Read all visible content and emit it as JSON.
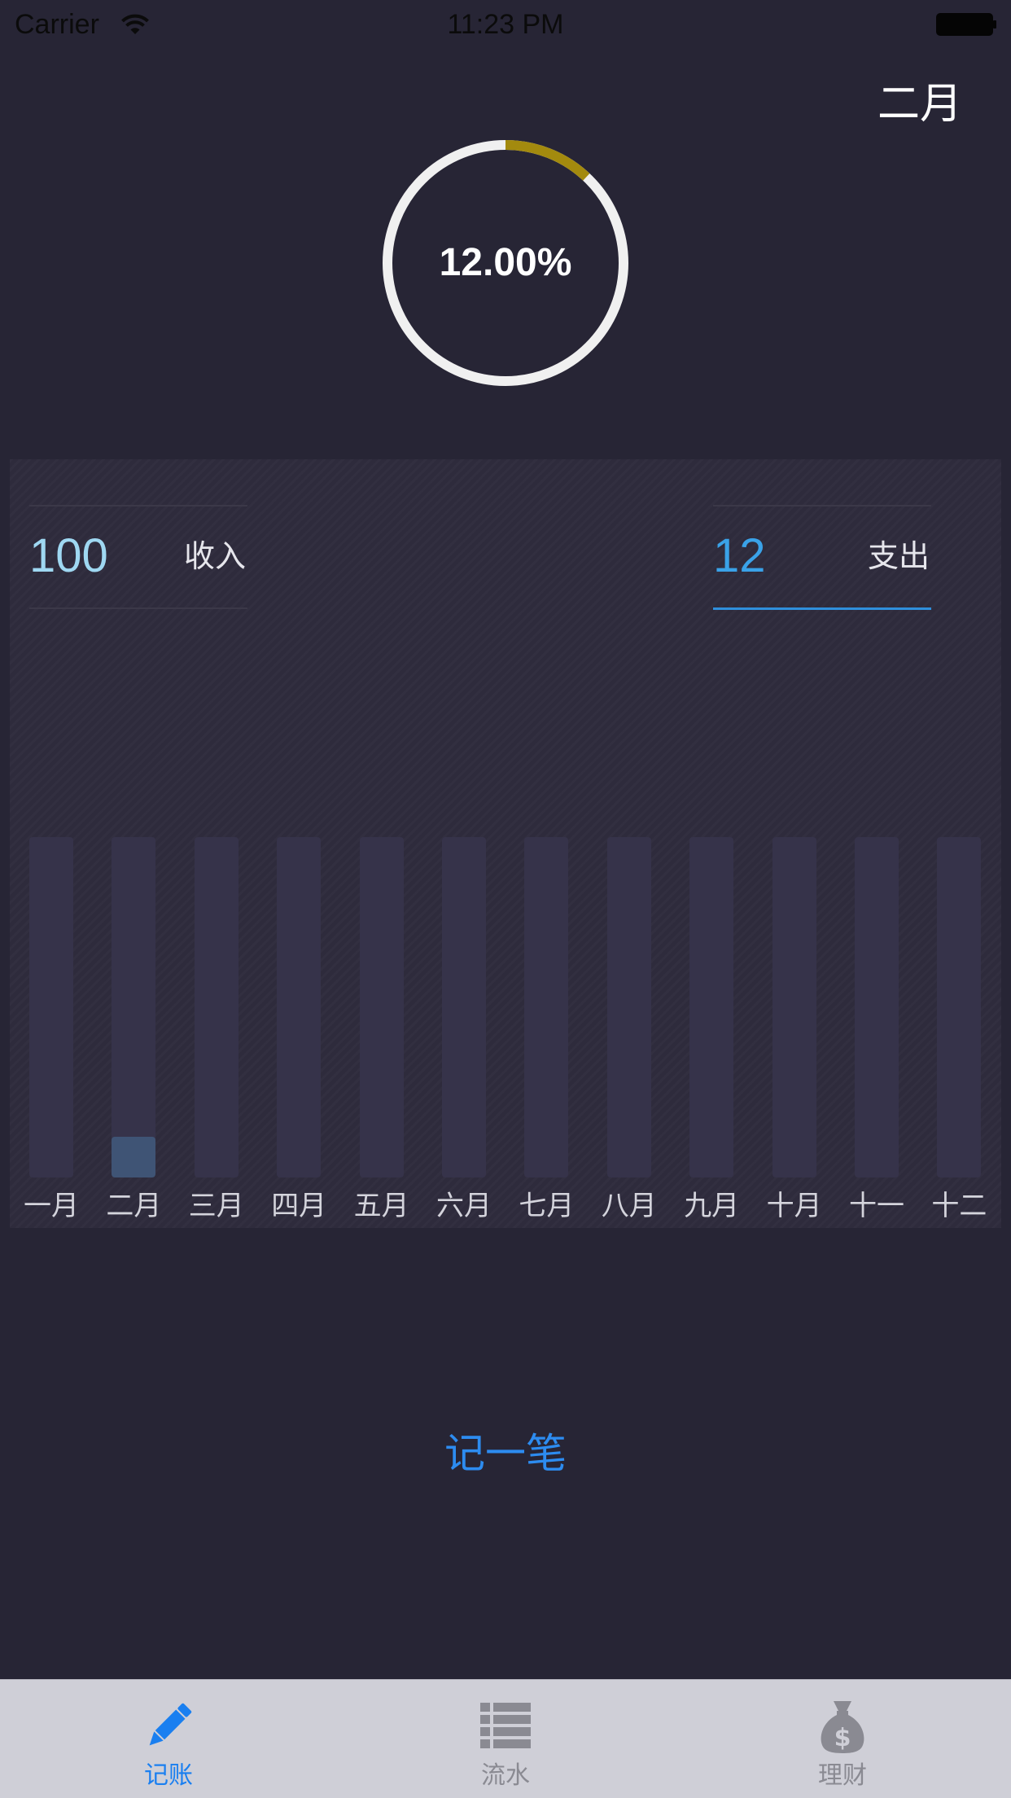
{
  "status_bar": {
    "carrier": "Carrier",
    "time": "11:23 PM",
    "icons": [
      "wifi-icon",
      "battery-icon"
    ]
  },
  "header": {
    "month": "二月"
  },
  "progress_ring": {
    "percent_text": "12.00%",
    "fraction": 0.12,
    "track_color": "#f0f0f0",
    "progress_color": "#a38a0e"
  },
  "summary": {
    "income": {
      "value": "100",
      "label": "收入"
    },
    "expense": {
      "value": "12",
      "label": "支出"
    },
    "selected": "expense",
    "accent_color": "#2f8fdc"
  },
  "chart_data": {
    "type": "bar",
    "categories": [
      "一月",
      "二月",
      "三月",
      "四月",
      "五月",
      "六月",
      "七月",
      "八月",
      "九月",
      "十月",
      "十一",
      "十二"
    ],
    "values": [
      0,
      12,
      0,
      0,
      0,
      0,
      0,
      0,
      0,
      0,
      0,
      0
    ],
    "ylim": [
      0,
      100
    ],
    "track_color": "#36334a",
    "bar_color": "#3f5475",
    "grid": false
  },
  "actions": {
    "record_label": "记一笔"
  },
  "tab_bar": {
    "active_color": "#1a7ff0",
    "inactive_color": "#8a8a92",
    "tabs": [
      {
        "label": "记账",
        "icon": "pencil-icon",
        "active": true
      },
      {
        "label": "流水",
        "icon": "list-icon",
        "active": false
      },
      {
        "label": "理财",
        "icon": "money-bag-icon",
        "active": false
      }
    ]
  }
}
